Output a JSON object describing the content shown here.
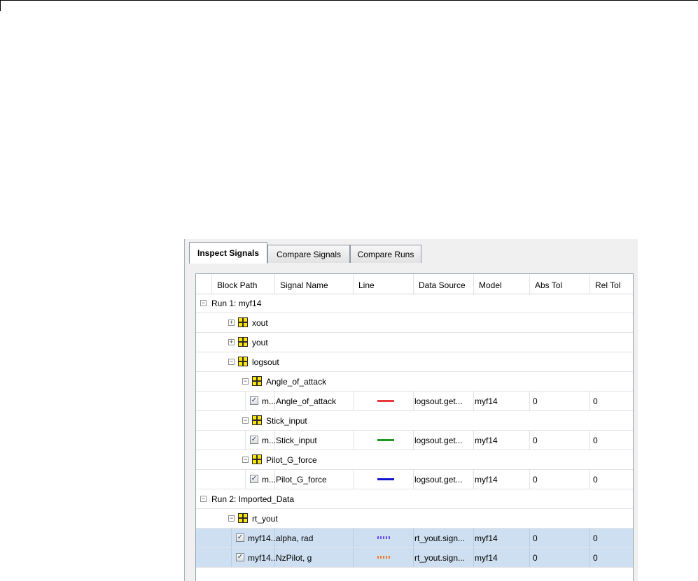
{
  "tabs": [
    {
      "label": "Inspect Signals",
      "active": true
    },
    {
      "label": "Compare Signals",
      "active": false
    },
    {
      "label": "Compare Runs",
      "active": false
    }
  ],
  "columns": [
    "Block Path",
    "Signal Name",
    "Line",
    "Data Source",
    "Model",
    "Abs Tol",
    "Rel Tol"
  ],
  "rows": [
    {
      "kind": "run",
      "indent": 0,
      "expander": "−",
      "label": "Run 1: myf14"
    },
    {
      "kind": "group",
      "indent": 1,
      "expander": "+",
      "label": "xout"
    },
    {
      "kind": "group",
      "indent": 1,
      "expander": "+",
      "label": "yout"
    },
    {
      "kind": "group",
      "indent": 1,
      "expander": "−",
      "label": "logsout"
    },
    {
      "kind": "group",
      "indent": 2,
      "expander": "−",
      "label": "Angle_of_attack"
    },
    {
      "kind": "signal",
      "indent": 3,
      "checked": true,
      "block_path": "m...",
      "signal_name": "Angle_of_attack",
      "line_color": "#e8383d",
      "line_style": "solid",
      "data_source": "logsout.get...",
      "model": "myf14",
      "abs_tol": "0",
      "rel_tol": "0"
    },
    {
      "kind": "group",
      "indent": 2,
      "expander": "−",
      "label": "Stick_input"
    },
    {
      "kind": "signal",
      "indent": 3,
      "checked": true,
      "block_path": "m...",
      "signal_name": "Stick_input",
      "line_color": "#1f9a1f",
      "line_style": "solid",
      "data_source": "logsout.get...",
      "model": "myf14",
      "abs_tol": "0",
      "rel_tol": "0"
    },
    {
      "kind": "group",
      "indent": 2,
      "expander": "−",
      "label": "Pilot_G_force"
    },
    {
      "kind": "signal",
      "indent": 3,
      "checked": true,
      "block_path": "m...",
      "signal_name": "Pilot_G_force",
      "line_color": "#1414d0",
      "line_style": "solid",
      "data_source": "logsout.get...",
      "model": "myf14",
      "abs_tol": "0",
      "rel_tol": "0"
    },
    {
      "kind": "run",
      "indent": 0,
      "expander": "−",
      "label": "Run 2: Imported_Data"
    },
    {
      "kind": "group",
      "indent": 1,
      "expander": "−",
      "label": "rt_yout"
    },
    {
      "kind": "signal",
      "indent": 2,
      "checked": true,
      "selected": true,
      "block_path": "myf14...",
      "signal_name": "alpha, rad",
      "line_color": "#6a4cf0",
      "line_style": "dotted",
      "data_source": "rt_yout.sign...",
      "model": "myf14",
      "abs_tol": "0",
      "rel_tol": "0"
    },
    {
      "kind": "signal",
      "indent": 2,
      "checked": true,
      "selected": true,
      "block_path": "myf14...",
      "signal_name": "NzPilot, g",
      "line_color": "#f07a28",
      "line_style": "dotted",
      "data_source": "rt_yout.sign...",
      "model": "myf14",
      "abs_tol": "0",
      "rel_tol": "0"
    }
  ],
  "icons": {
    "expand": "plus-box-icon",
    "collapse": "minus-box-icon",
    "bus": "bus-signal-icon",
    "check": "checkbox-icon"
  },
  "colors": {
    "selection": "#cddff0",
    "bus_icon": "#ffe600"
  }
}
